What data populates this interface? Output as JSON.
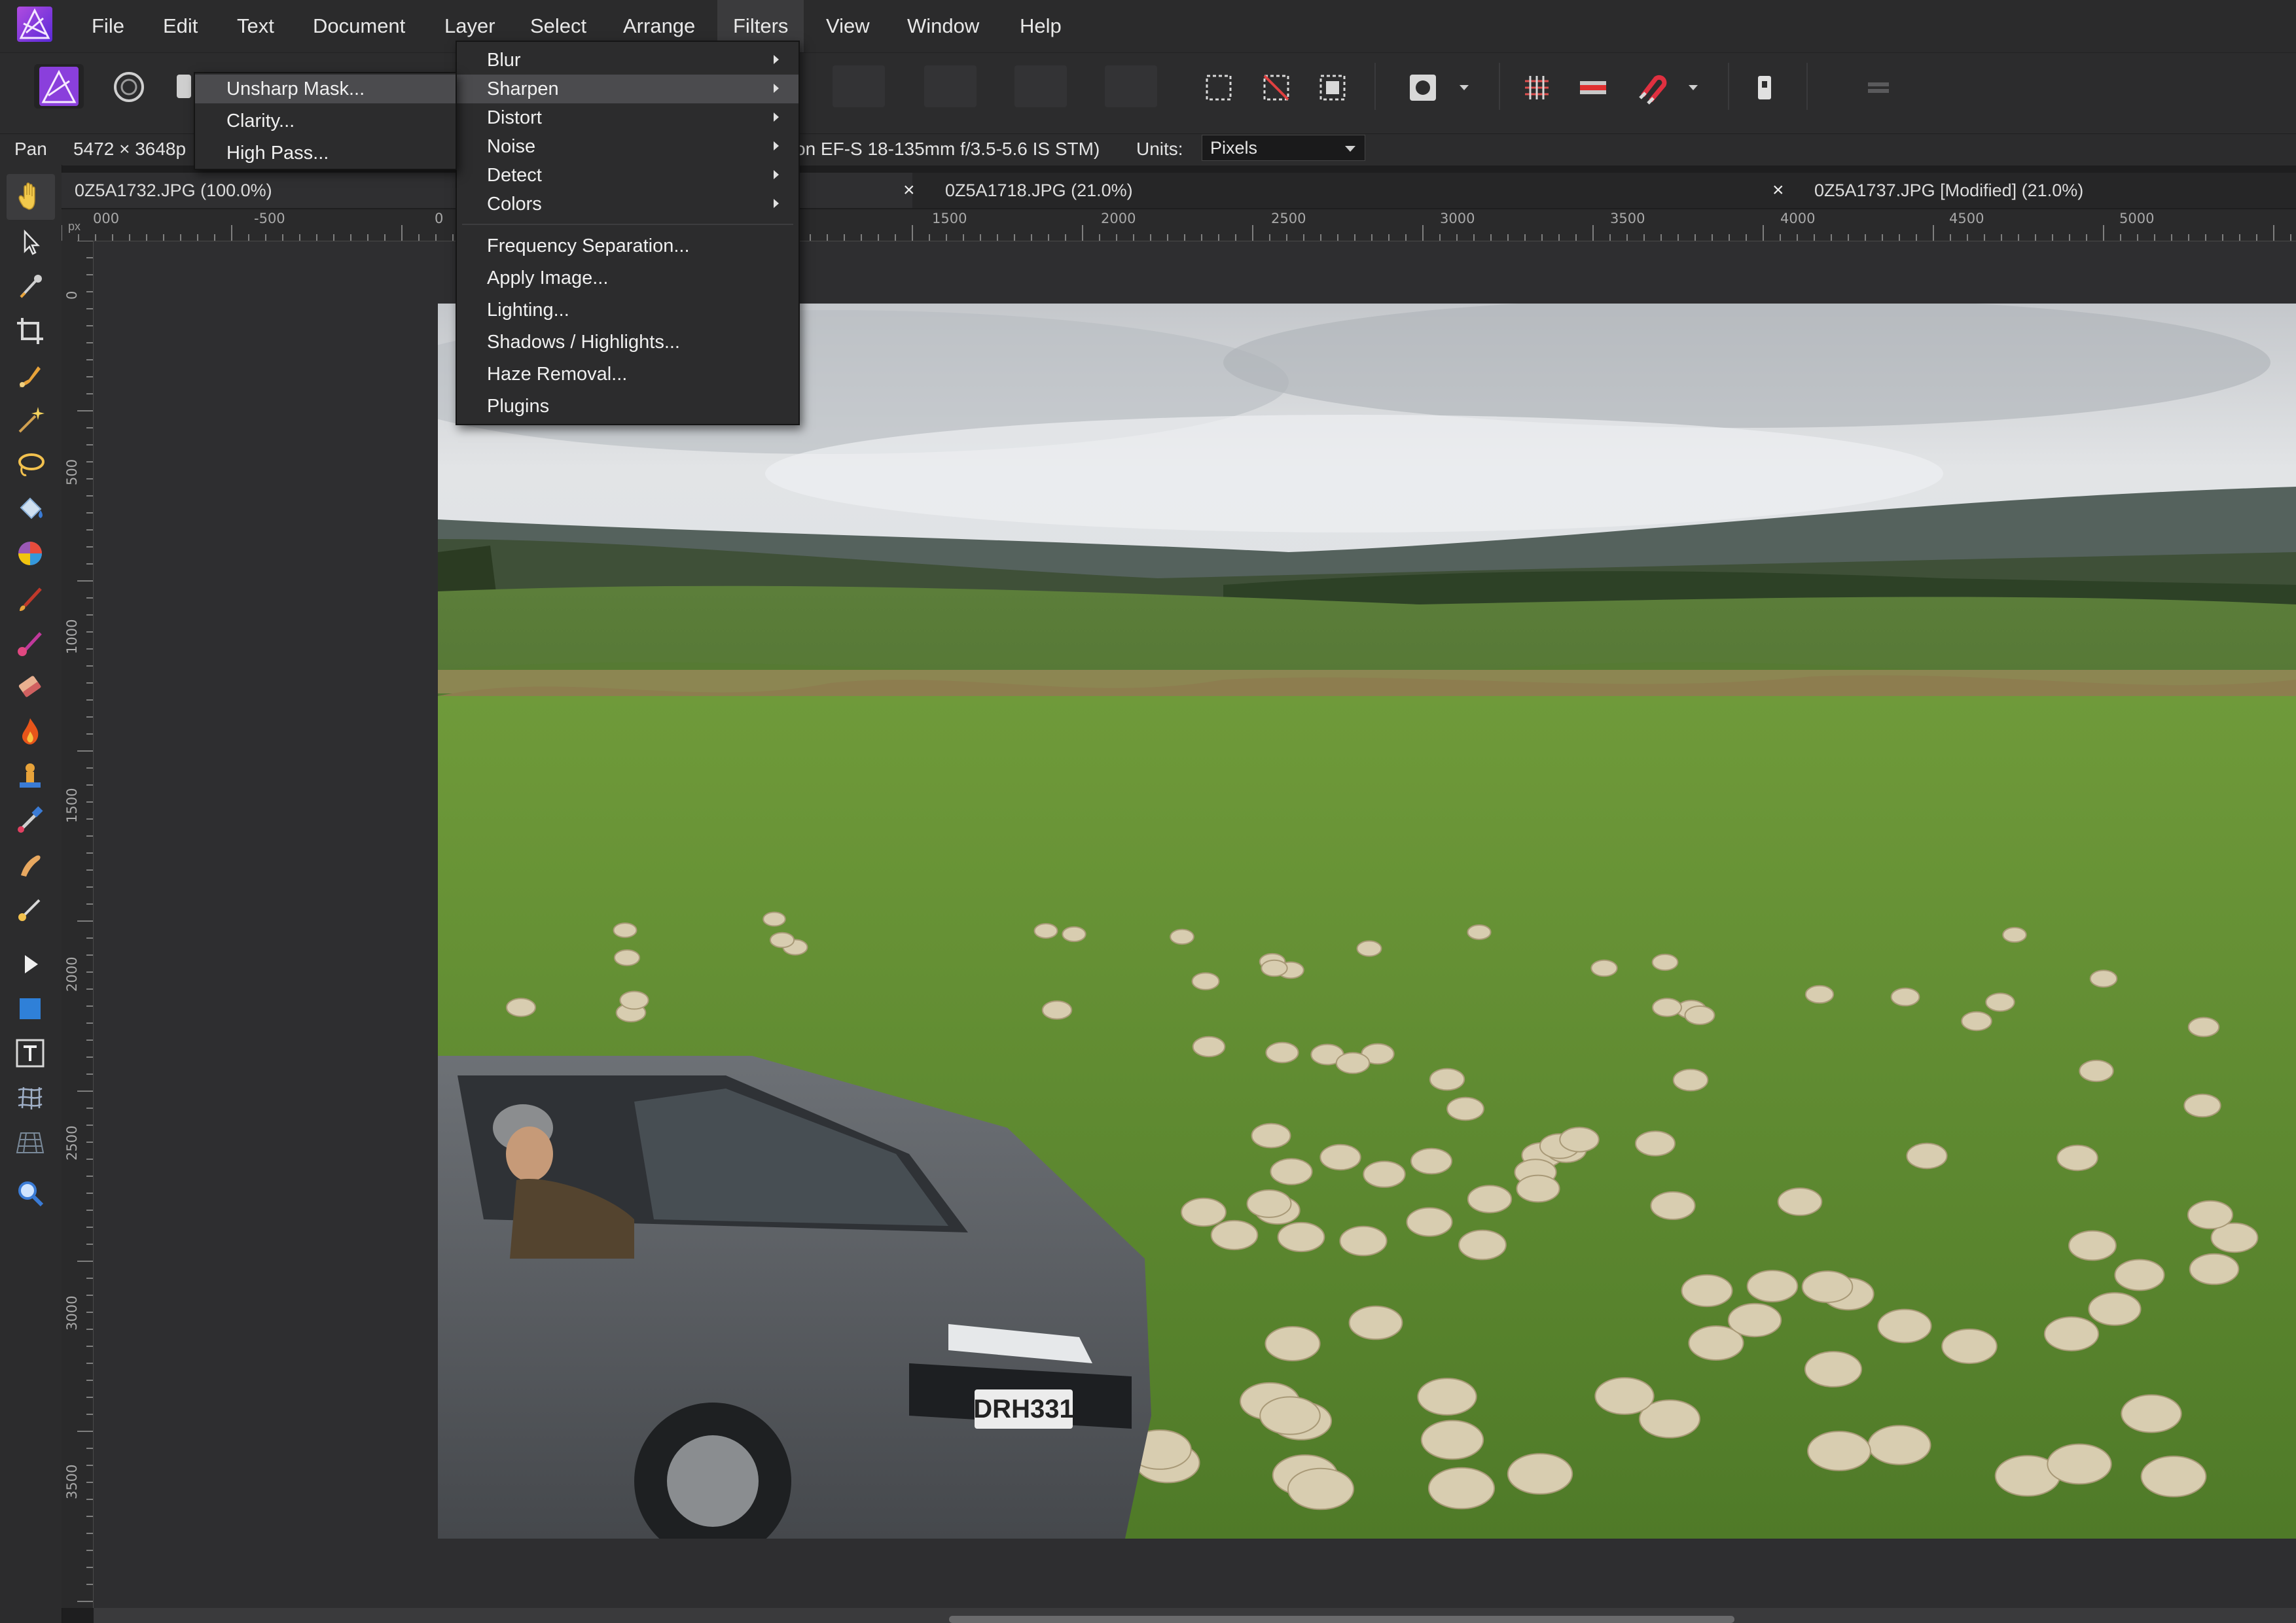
{
  "menubar": {
    "items": [
      "File",
      "Edit",
      "Text",
      "Document",
      "Layer",
      "Select",
      "Arrange",
      "Filters",
      "View",
      "Window",
      "Help"
    ],
    "active": "Filters"
  },
  "context": {
    "tool": "Pan",
    "dimensions": "5472 × 3648p",
    "lens": "on EF-S 18-135mm f/3.5-5.6 IS STM)",
    "units_label": "Units:",
    "units_value": "Pixels"
  },
  "tabs": [
    {
      "label": "0Z5A1732.JPG (100.0%)",
      "close": ""
    },
    {
      "label": "0Z5A1718.JPG (21.0%)",
      "close": "×"
    },
    {
      "label": "0Z5A1737.JPG [Modified] (21.0%)",
      "close": "×"
    }
  ],
  "ruler_h": {
    "unit": "px",
    "labels": [
      "000",
      "-500",
      "0",
      "1500",
      "2000",
      "2500",
      "3000",
      "3500",
      "4000",
      "4500",
      "5000"
    ]
  },
  "ruler_v": {
    "labels": [
      "0",
      "500",
      "1000",
      "1500",
      "2000",
      "2500",
      "3000",
      "3500"
    ]
  },
  "filters_menu": {
    "items": [
      {
        "label": "Blur",
        "submenu": true
      },
      {
        "label": "Sharpen",
        "submenu": true,
        "highlighted": true
      },
      {
        "label": "Distort",
        "submenu": true
      },
      {
        "label": "Noise",
        "submenu": true
      },
      {
        "label": "Detect",
        "submenu": true
      },
      {
        "label": "Colors",
        "submenu": true
      },
      {
        "label": "Frequency Separation...",
        "submenu": false
      },
      {
        "label": "Apply Image...",
        "submenu": false
      },
      {
        "label": "Lighting...",
        "submenu": false
      },
      {
        "label": "Shadows / Highlights...",
        "submenu": false
      },
      {
        "label": "Haze Removal...",
        "submenu": false
      },
      {
        "label": "Plugins",
        "submenu": false
      }
    ]
  },
  "sharpen_submenu": {
    "items": [
      {
        "label": "Unsharp Mask...",
        "highlighted": true
      },
      {
        "label": "Clarity...",
        "highlighted": false
      },
      {
        "label": "High Pass...",
        "highlighted": false
      }
    ]
  },
  "photo": {
    "plate": "DRH331"
  },
  "colors": {
    "accent": "#7a3bd6",
    "menu_bg": "#2c2c2d",
    "highlight": "#4b4b4e"
  }
}
